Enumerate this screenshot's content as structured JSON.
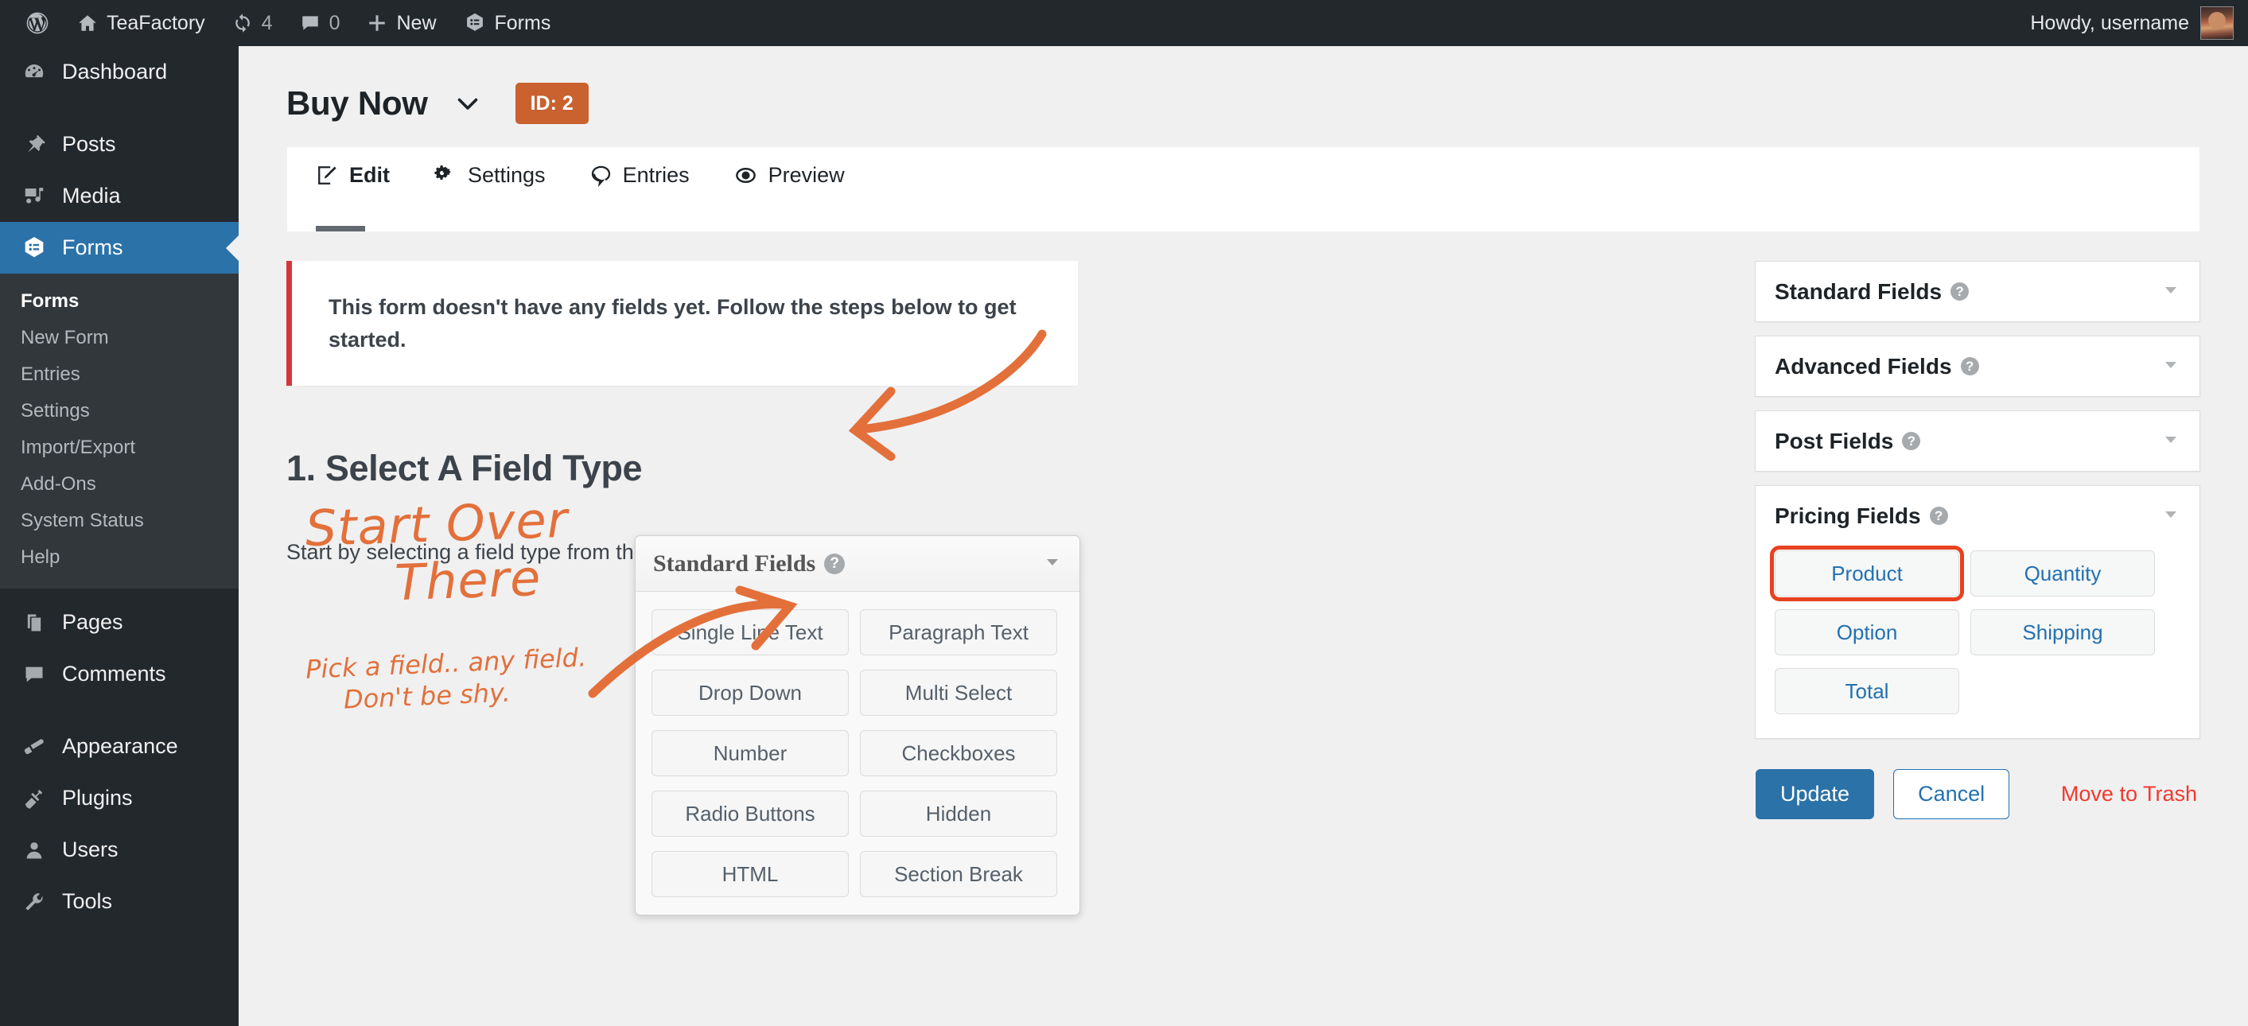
{
  "adminbar": {
    "wp_logo": "wordpress-logo-icon",
    "items": [
      {
        "icon": "home-icon",
        "label": "TeaFactory"
      },
      {
        "icon": "updates-icon",
        "label": "4"
      },
      {
        "icon": "comment-icon",
        "label": "0"
      },
      {
        "icon": "plus-icon",
        "label": "New"
      },
      {
        "icon": "forms-icon",
        "label": "Forms"
      }
    ],
    "howdy": "Howdy, username",
    "avatar": "user-avatar"
  },
  "sidebar": {
    "items": [
      {
        "label": "Dashboard",
        "icon": "dashboard-icon",
        "current": false
      },
      {
        "label": "Posts",
        "icon": "pin-icon",
        "current": false
      },
      {
        "label": "Media",
        "icon": "media-icon",
        "current": false
      },
      {
        "label": "Forms",
        "icon": "forms-icon",
        "current": true
      },
      {
        "label": "Pages",
        "icon": "pages-icon",
        "current": false
      },
      {
        "label": "Comments",
        "icon": "comment-icon",
        "current": false
      },
      {
        "label": "Appearance",
        "icon": "brush-icon",
        "current": false
      },
      {
        "label": "Plugins",
        "icon": "plug-icon",
        "current": false
      },
      {
        "label": "Users",
        "icon": "user-icon",
        "current": false
      },
      {
        "label": "Tools",
        "icon": "wrench-icon",
        "current": false
      }
    ],
    "submenu": [
      {
        "label": "Forms",
        "current": true
      },
      {
        "label": "New Form",
        "current": false
      },
      {
        "label": "Entries",
        "current": false
      },
      {
        "label": "Settings",
        "current": false
      },
      {
        "label": "Import/Export",
        "current": false
      },
      {
        "label": "Add-Ons",
        "current": false
      },
      {
        "label": "System Status",
        "current": false
      },
      {
        "label": "Help",
        "current": false
      }
    ]
  },
  "form_header": {
    "title": "Buy Now",
    "chevron": "chevron-down-icon",
    "id_badge": "ID: 2",
    "badge_color": "#c9622f"
  },
  "tabs": [
    {
      "label": "Edit",
      "icon": "edit-pencil-icon",
      "active": true
    },
    {
      "label": "Settings",
      "icon": "gears-icon",
      "active": false
    },
    {
      "label": "Entries",
      "icon": "speech-bubble-icon",
      "active": false
    },
    {
      "label": "Preview",
      "icon": "eye-icon",
      "active": false
    }
  ],
  "notice": {
    "text": "This form doesn't have any fields yet. Follow the steps below to get started.",
    "accent_color": "#d63638"
  },
  "step": {
    "heading": "1. Select A Field Type",
    "description": "Start by selecting a field type from the nifty floating panels on the right."
  },
  "annotations": {
    "color": "#e3703a",
    "big_line1": "Start Over",
    "big_line2": "There",
    "small_line1": "Pick a field.. any field.",
    "small_line2": "Don't be shy.",
    "arrow_to_notice": "curved-arrow-icon",
    "arrow_to_panel": "curved-arrow-icon"
  },
  "floating_panel": {
    "title": "Standard Fields",
    "help_icon": "help-icon",
    "collapse_icon": "chevron-down-icon",
    "buttons": [
      "Single Line Text",
      "Paragraph Text",
      "Drop Down",
      "Multi Select",
      "Number",
      "Checkboxes",
      "Radio Buttons",
      "Hidden",
      "HTML",
      "Section Break"
    ]
  },
  "side_panels": [
    {
      "title": "Standard Fields",
      "help_icon": "help-icon",
      "collapse_icon": "chevron-down-icon",
      "expanded": false,
      "buttons": []
    },
    {
      "title": "Advanced Fields",
      "help_icon": "help-icon",
      "collapse_icon": "chevron-down-icon",
      "expanded": false,
      "buttons": []
    },
    {
      "title": "Post Fields",
      "help_icon": "help-icon",
      "collapse_icon": "chevron-down-icon",
      "expanded": false,
      "buttons": []
    },
    {
      "title": "Pricing Fields",
      "help_icon": "help-icon",
      "collapse_icon": "chevron-down-icon",
      "expanded": true,
      "buttons": [
        {
          "label": "Product",
          "highlighted": true
        },
        {
          "label": "Quantity",
          "highlighted": false
        },
        {
          "label": "Option",
          "highlighted": false
        },
        {
          "label": "Shipping",
          "highlighted": false
        },
        {
          "label": "Total",
          "highlighted": false
        }
      ]
    }
  ],
  "actions": {
    "update": "Update",
    "cancel": "Cancel",
    "trash": "Move to Trash",
    "primary_color": "#2b72a8",
    "trash_color": "#f1392c",
    "highlight_color": "#e8411f"
  }
}
